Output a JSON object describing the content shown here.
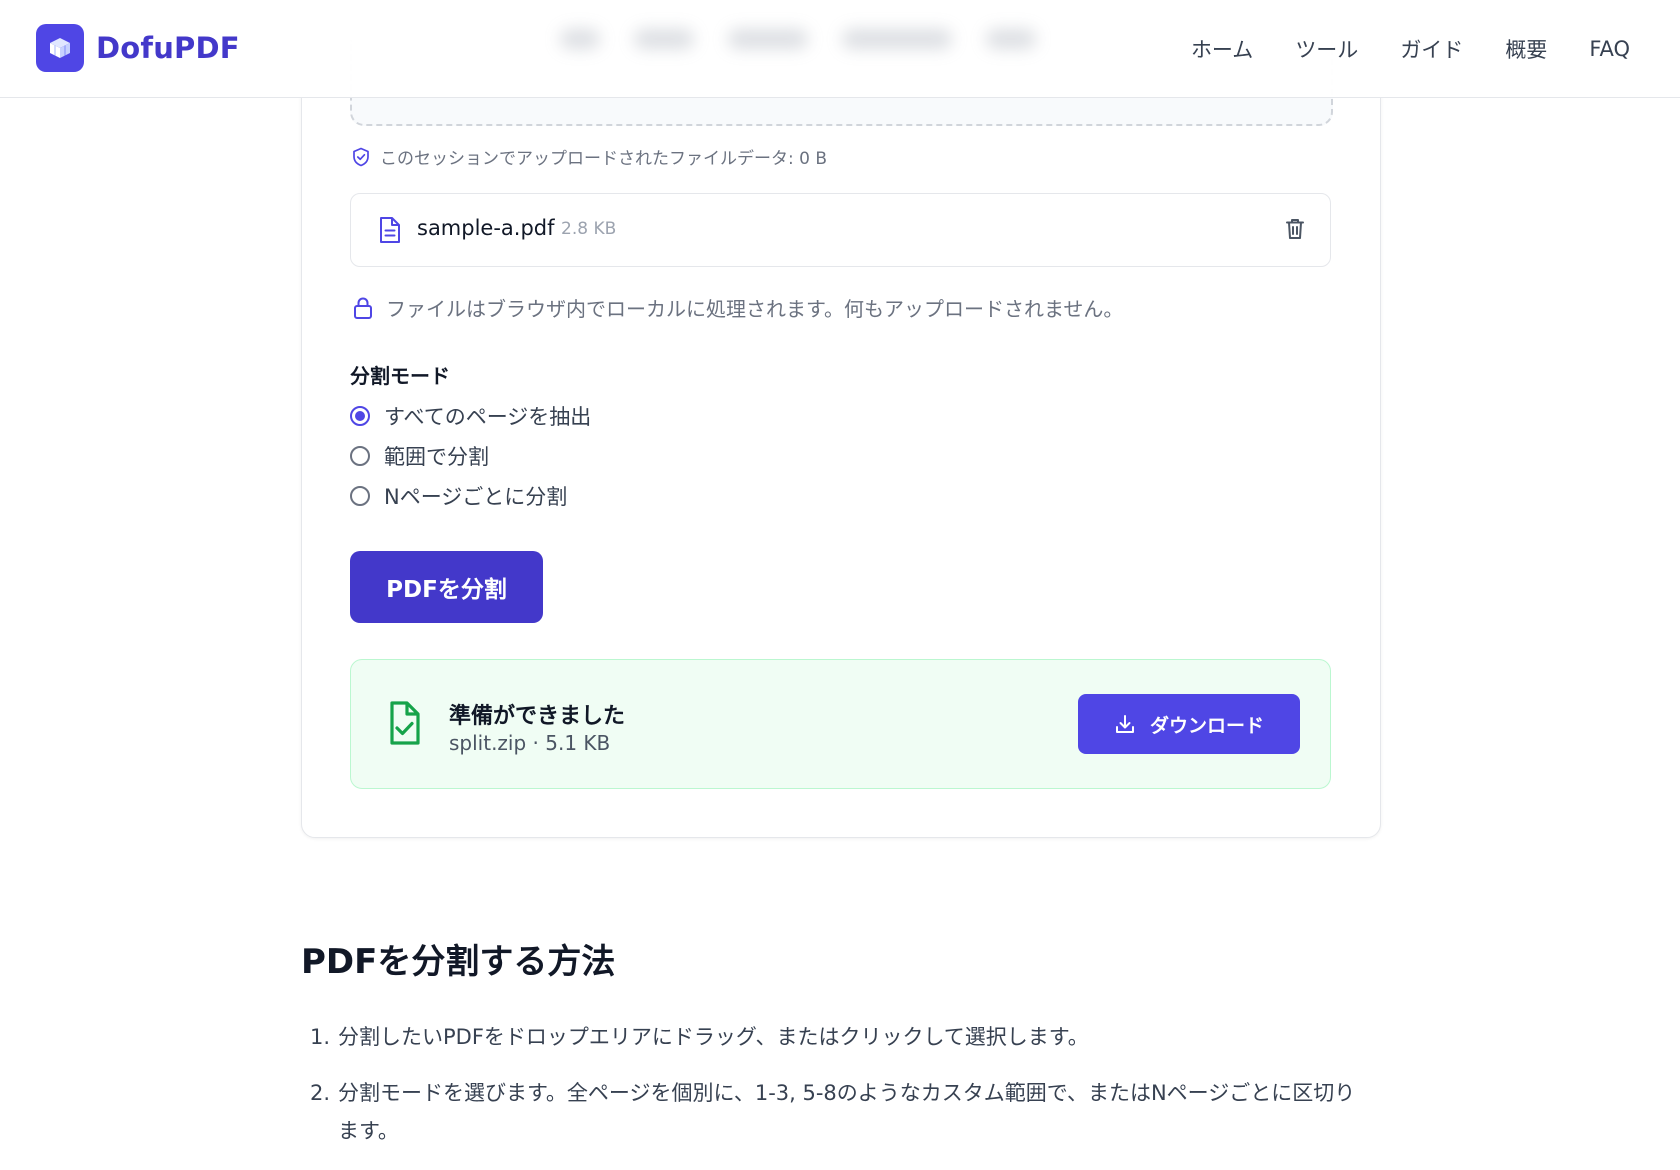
{
  "header": {
    "brand": "DofuPDF",
    "nav": [
      "ホーム",
      "ツール",
      "ガイド",
      "概要",
      "FAQ"
    ]
  },
  "tool": {
    "session_note": "このセッションでアップロードされたファイルデータ: 0 B",
    "file": {
      "name": "sample-a.pdf",
      "size": "2.8 KB"
    },
    "local_note": "ファイルはブラウザ内でローカルに処理されます。何もアップロードされません。",
    "mode_title": "分割モード",
    "modes": [
      {
        "label": "すべてのページを抽出",
        "selected": true
      },
      {
        "label": "範囲で分割",
        "selected": false
      },
      {
        "label": "Nページごとに分割",
        "selected": false
      }
    ],
    "split_button": "PDFを分割",
    "result": {
      "title": "準備ができました",
      "file": "split.zip · 5.1 KB",
      "download_button": "ダウンロード"
    }
  },
  "howto": {
    "title": "PDFを分割する方法",
    "steps": [
      {
        "num": "1.",
        "text": "分割したいPDFをドロップエリアにドラッグ、またはクリックして選択します。"
      },
      {
        "num": "2.",
        "text": "分割モードを選びます。全ページを個別に、1-3, 5-8のようなカスタム範囲で、またはNページごとに区切ります。"
      }
    ]
  },
  "colors": {
    "accent": "#4f46e5",
    "accent_dark": "#4338ca",
    "success": "#16a34a",
    "success_bg": "#f0fdf4"
  }
}
